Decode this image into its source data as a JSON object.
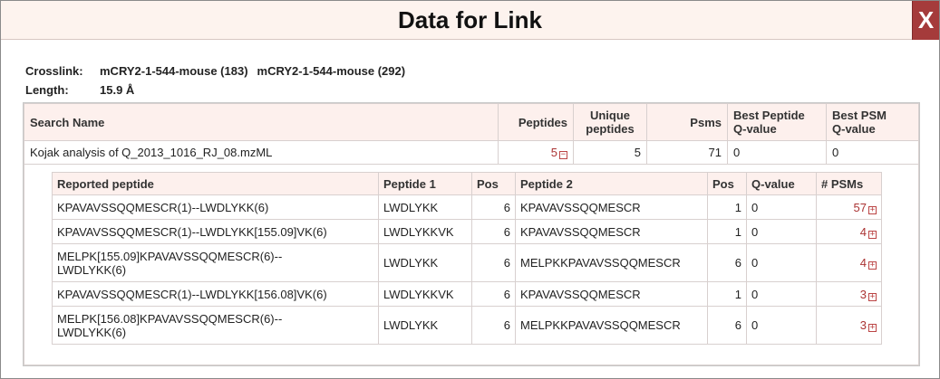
{
  "dialog": {
    "title": "Data for Link",
    "close_label": "X"
  },
  "info": {
    "crosslink_label": "Crosslink:",
    "protein1": "mCRY2-1-544-mouse (183)",
    "protein2": "mCRY2-1-544-mouse (292)",
    "length_label": "Length:",
    "length_value": "15.9 Å"
  },
  "outer_table": {
    "headers": {
      "search_name": "Search Name",
      "peptides": "Peptides",
      "unique_peptides_line1": "Unique",
      "unique_peptides_line2": "peptides",
      "psms": "Psms",
      "best_peptide_q_line1": "Best Peptide",
      "best_peptide_q_line2": "Q-value",
      "best_psm_q_line1": "Best PSM",
      "best_psm_q_line2": "Q-value"
    },
    "row": {
      "search_name": "Kojak analysis of Q_2013_1016_RJ_08.mzML",
      "peptides": "5",
      "unique_peptides": "5",
      "psms": "71",
      "best_peptide_q": "0",
      "best_psm_q": "0"
    }
  },
  "inner_table": {
    "headers": {
      "reported_peptide": "Reported peptide",
      "peptide1": "Peptide 1",
      "pos1": "Pos",
      "peptide2": "Peptide 2",
      "pos2": "Pos",
      "qvalue": "Q-value",
      "num_psms": "# PSMs"
    },
    "rows": [
      {
        "reported_line1": "KPAVAVSSQQMESCR(1)--LWDLYKK(6)",
        "reported_line2": "",
        "peptide1": "LWDLYKK",
        "pos1": "6",
        "peptide2": "KPAVAVSSQQMESCR",
        "pos2": "1",
        "qvalue": "0",
        "psms": "57"
      },
      {
        "reported_line1": "KPAVAVSSQQMESCR(1)--LWDLYKK[155.09]VK(6)",
        "reported_line2": "",
        "peptide1": "LWDLYKKVK",
        "pos1": "6",
        "peptide2": "KPAVAVSSQQMESCR",
        "pos2": "1",
        "qvalue": "0",
        "psms": "4"
      },
      {
        "reported_line1": "MELPK[155.09]KPAVAVSSQQMESCR(6)--",
        "reported_line2": "LWDLYKK(6)",
        "peptide1": "LWDLYKK",
        "pos1": "6",
        "peptide2": "MELPKKPAVAVSSQQMESCR",
        "pos2": "6",
        "qvalue": "0",
        "psms": "4"
      },
      {
        "reported_line1": "KPAVAVSSQQMESCR(1)--LWDLYKK[156.08]VK(6)",
        "reported_line2": "",
        "peptide1": "LWDLYKKVK",
        "pos1": "6",
        "peptide2": "KPAVAVSSQQMESCR",
        "pos2": "1",
        "qvalue": "0",
        "psms": "3"
      },
      {
        "reported_line1": "MELPK[156.08]KPAVAVSSQQMESCR(6)--",
        "reported_line2": "LWDLYKK(6)",
        "peptide1": "LWDLYKK",
        "pos1": "6",
        "peptide2": "MELPKKPAVAVSSQQMESCR",
        "pos2": "6",
        "qvalue": "0",
        "psms": "3"
      }
    ]
  },
  "colors": {
    "accent_red": "#a53b3b",
    "header_bg": "#fdf0ed",
    "title_bg": "#fdf3ee"
  }
}
